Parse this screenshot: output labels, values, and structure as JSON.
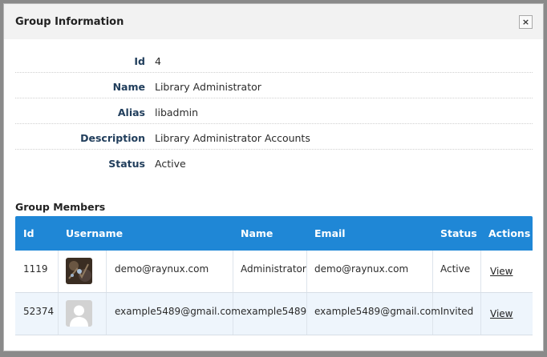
{
  "dialog": {
    "title": "Group Information",
    "close_label": "×"
  },
  "info": {
    "id_label": "Id",
    "id_value": "4",
    "name_label": "Name",
    "name_value": "Library Administrator",
    "alias_label": "Alias",
    "alias_value": "libadmin",
    "description_label": "Description",
    "description_value": "Library Administrator Accounts",
    "status_label": "Status",
    "status_value": "Active"
  },
  "members": {
    "title": "Group Members",
    "headers": {
      "id": "Id",
      "username": "Username",
      "name": "Name",
      "email": "Email",
      "status": "Status",
      "actions": "Actions"
    },
    "header_color": "#1f87d6",
    "rows": [
      {
        "id": "1119",
        "avatar": "photo-avatar",
        "username": "demo@raynux.com",
        "name": "Administrator",
        "email": "demo@raynux.com",
        "status": "Active",
        "action": "View"
      },
      {
        "id": "52374",
        "avatar": "placeholder-avatar",
        "username": "example5489@gmail.com",
        "name": "example5489",
        "email": "example5489@gmail.com",
        "status": "Invited",
        "action": "View"
      }
    ]
  }
}
